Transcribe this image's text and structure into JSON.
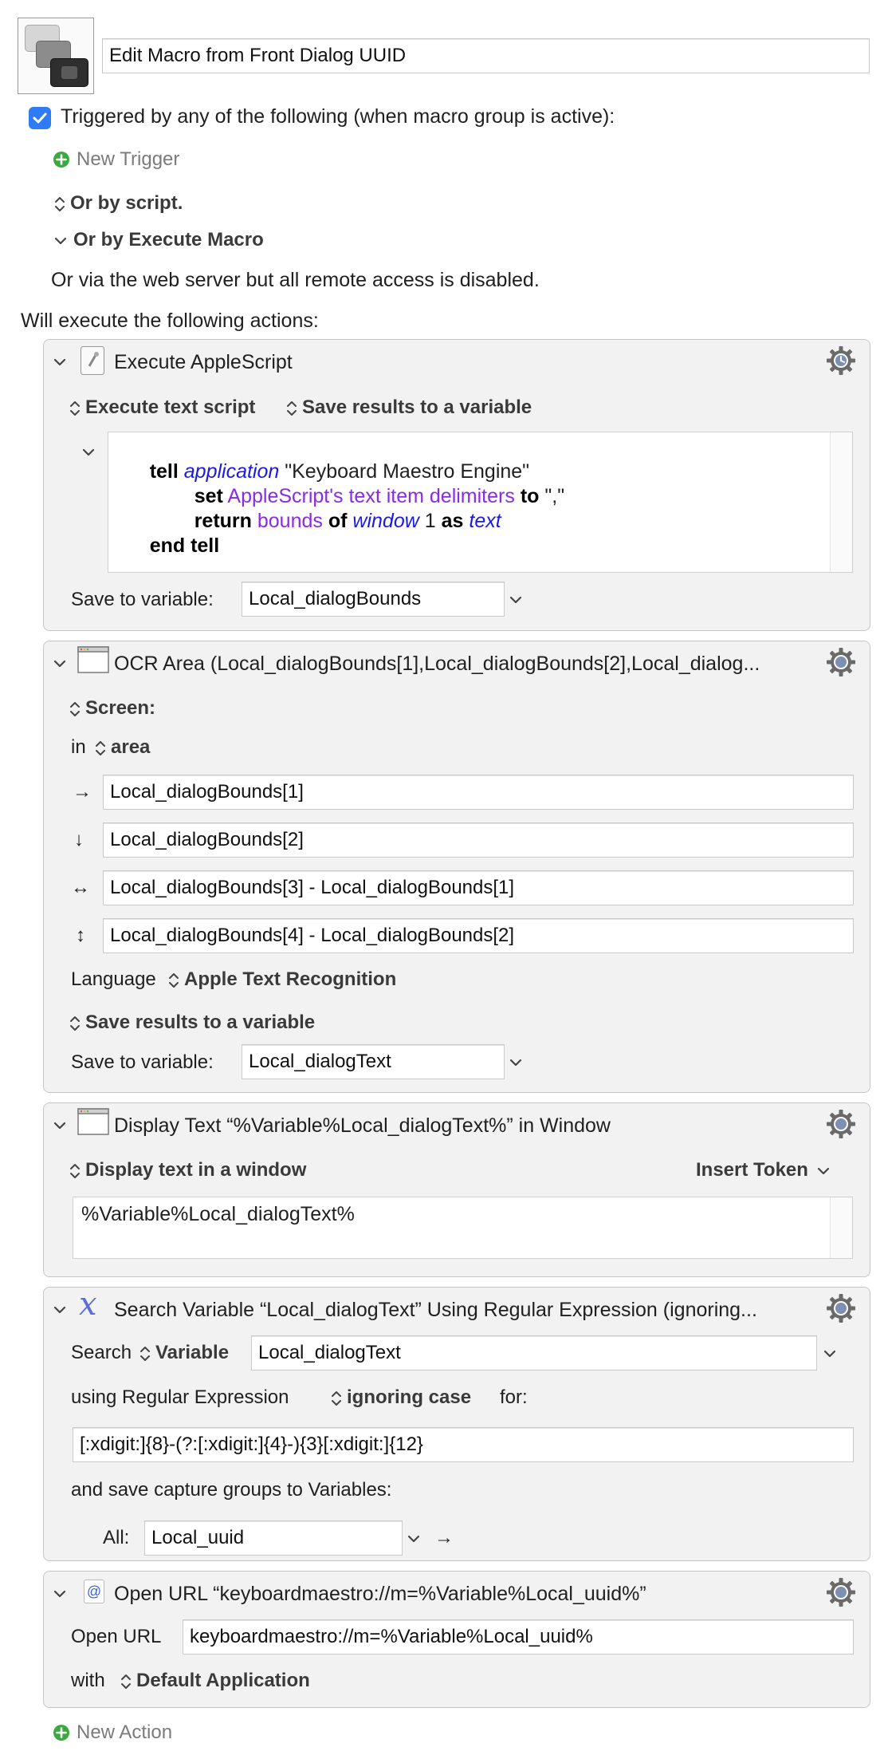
{
  "macro": {
    "name": "Edit Macro from Front Dialog UUID",
    "trigger_label": "Triggered by any of the following (when macro group is active):",
    "trigger_checked": true,
    "new_trigger": "New Trigger",
    "or_by_script": "Or by script.",
    "or_by_execute_macro": "Or by Execute Macro",
    "web_server_note": "Or via the web server but all remote access is disabled.",
    "will_execute": "Will execute the following actions:",
    "new_action": "New Action"
  },
  "actions": {
    "applescript": {
      "title": "Execute AppleScript",
      "mode": "Execute text script",
      "save_mode": "Save results to a variable",
      "code": {
        "l1_tell": "tell",
        "l1_application": "application",
        "l1_string": "\"Keyboard Maestro Engine\"",
        "l2_set": "set",
        "l2_prop": "AppleScript's text item delimiters",
        "l2_to": "to",
        "l2_string": "\",\"",
        "l3_return": "return",
        "l3_bounds": "bounds",
        "l3_of": "of",
        "l3_window": "window",
        "l3_num": "1",
        "l3_as": "as",
        "l3_text": "text",
        "l4_end": "end tell"
      },
      "save_label": "Save to variable:",
      "save_variable": "Local_dialogBounds"
    },
    "ocr": {
      "title": "OCR Area (Local_dialogBounds[1],Local_dialogBounds[2],Local_dialog...",
      "screen_label": "Screen:",
      "in_label": "in",
      "area_label": "area",
      "left": "Local_dialogBounds[1]",
      "top": "Local_dialogBounds[2]",
      "width": "Local_dialogBounds[3] - Local_dialogBounds[1]",
      "height": "Local_dialogBounds[4] - Local_dialogBounds[2]",
      "language_label": "Language",
      "language_value": "Apple Text Recognition",
      "save_mode": "Save results to a variable",
      "save_label": "Save to variable:",
      "save_variable": "Local_dialogText"
    },
    "display": {
      "title": "Display Text “%Variable%Local_dialogText%” in Window",
      "mode": "Display text in a window",
      "insert_token": "Insert Token",
      "text": "%Variable%Local_dialogText%"
    },
    "search": {
      "title": "Search Variable “Local_dialogText” Using Regular Expression (ignoring...",
      "search_label": "Search",
      "variable_label": "Variable",
      "variable_value": "Local_dialogText",
      "using_label": "using Regular Expression",
      "case_label": "ignoring case",
      "for_label": "for:",
      "regex": "[:xdigit:]{8}-(?:[:xdigit:]{4}-){3}[:xdigit:]{12}",
      "capture_label": "and save capture groups to Variables:",
      "all_label": "All:",
      "all_value": "Local_uuid"
    },
    "openurl": {
      "title": "Open URL “keyboardmaestro://m=%Variable%Local_uuid%”",
      "open_label": "Open URL",
      "url": "keyboardmaestro://m=%Variable%Local_uuid%",
      "with_label": "with",
      "app_value": "Default Application"
    }
  },
  "colors": {
    "checkbox": "#2f7bf5",
    "keyword": "#000000",
    "class": "#1a1ae6",
    "property": "#8a2be2",
    "green_plus": "#3aa93f"
  }
}
